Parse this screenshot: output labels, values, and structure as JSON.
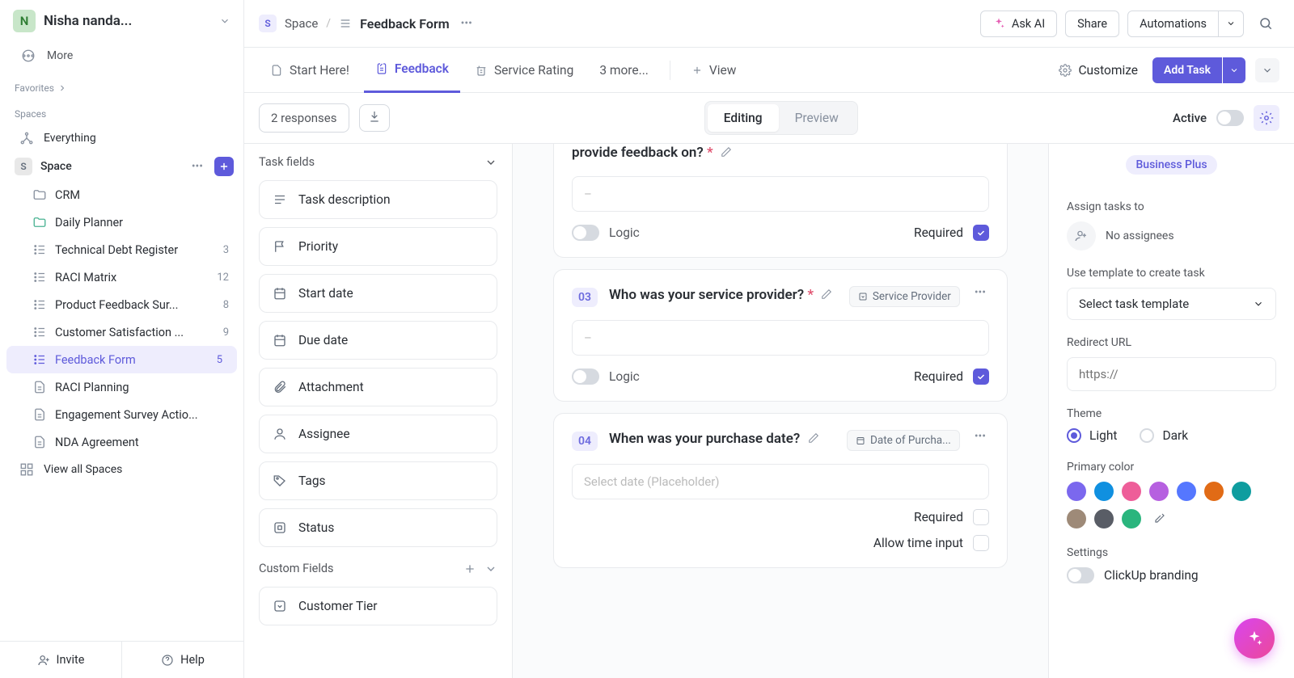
{
  "workspace": {
    "avatar_letter": "N",
    "name": "Nisha nanda..."
  },
  "sidebar": {
    "more_label": "More",
    "favorites_label": "Favorites",
    "spaces_label": "Spaces",
    "everything_label": "Everything",
    "space_name": "Space",
    "items": [
      {
        "label": "CRM",
        "type": "folder",
        "count": ""
      },
      {
        "label": "Daily Planner",
        "type": "folder-green",
        "count": ""
      },
      {
        "label": "Technical Debt Register",
        "type": "list",
        "count": "3"
      },
      {
        "label": "RACI Matrix",
        "type": "list",
        "count": "12"
      },
      {
        "label": "Product Feedback Sur...",
        "type": "list",
        "count": "8"
      },
      {
        "label": "Customer Satisfaction ...",
        "type": "list",
        "count": "9"
      },
      {
        "label": "Feedback Form",
        "type": "list",
        "count": "5",
        "active": true
      },
      {
        "label": "RACI Planning",
        "type": "doc",
        "count": ""
      },
      {
        "label": "Engagement Survey Actio...",
        "type": "doc",
        "count": ""
      },
      {
        "label": "NDA Agreement",
        "type": "doc",
        "count": ""
      }
    ],
    "view_all": "View all Spaces",
    "invite": "Invite",
    "help": "Help"
  },
  "breadcrumb": {
    "space": "Space",
    "page": "Feedback Form"
  },
  "topbar": {
    "ask_ai": "Ask AI",
    "share": "Share",
    "automations": "Automations"
  },
  "views": {
    "tabs": [
      "Start Here!",
      "Feedback",
      "Service Rating"
    ],
    "overflow": "3 more...",
    "add_view": "View",
    "customize": "Customize",
    "add_task": "Add Task"
  },
  "formbar": {
    "responses": "2 responses",
    "editing": "Editing",
    "preview": "Preview",
    "active": "Active"
  },
  "fields": {
    "header": "Task fields",
    "items": [
      "Task description",
      "Priority",
      "Start date",
      "Due date",
      "Attachment",
      "Assignee",
      "Tags",
      "Status"
    ],
    "custom_header": "Custom Fields",
    "custom_items": [
      "Customer Tier"
    ]
  },
  "questions": {
    "q_partial": {
      "title_fragment": "provide feedback on?",
      "placeholder": "–",
      "logic": "Logic",
      "required_label": "Required"
    },
    "q3": {
      "num": "03",
      "title": "Who was your service provider?",
      "badge": "Service Provider",
      "placeholder": "–",
      "logic": "Logic",
      "required_label": "Required"
    },
    "q4": {
      "num": "04",
      "title": "When was your purchase date?",
      "badge": "Date of Purcha...",
      "placeholder": "Select date (Placeholder)",
      "required_label": "Required",
      "allow_time": "Allow time input"
    }
  },
  "settings": {
    "plan_badge": "Business Plus",
    "assign_label": "Assign tasks to",
    "no_assignees": "No assignees",
    "template_label": "Use template to create task",
    "template_placeholder": "Select task template",
    "redirect_label": "Redirect URL",
    "redirect_placeholder": "https://",
    "theme_label": "Theme",
    "theme_light": "Light",
    "theme_dark": "Dark",
    "primary_label": "Primary color",
    "colors": [
      "#7b68ee",
      "#1090e0",
      "#ee5e99",
      "#b660e0",
      "#5577ff",
      "#e16b16",
      "#0f9d9f",
      "#9e8a78",
      "#595d66",
      "#2ab57d"
    ],
    "settings_label": "Settings",
    "branding": "ClickUp branding"
  }
}
